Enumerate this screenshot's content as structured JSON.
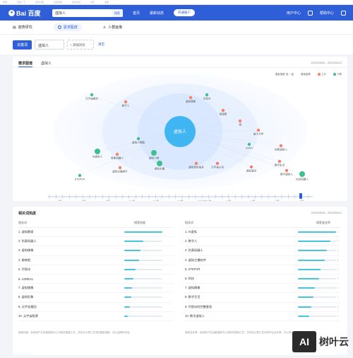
{
  "browser_bar": {
    "items": [
      "微博",
      "百度一下",
      "搜索引擎",
      "百度指数",
      "新标签页",
      "资讯",
      "收藏"
    ]
  },
  "topnav": {
    "logo": "Bai 百度",
    "search_value": "虚拟人",
    "search_button": "搜索",
    "links": [
      "首页",
      "最新动态"
    ],
    "pill": "开通账户",
    "right_items": [
      "用户中心",
      "帮助中心"
    ]
  },
  "subtabs": [
    "趋势研究",
    "需求图谱",
    "人群画像"
  ],
  "keywords": {
    "add_label": "关键词",
    "keyword": "虚拟人",
    "add_compare": "+ 添加对比",
    "clear": "清空"
  },
  "demand_card": {
    "tabs": [
      "需求图谱",
      "虚拟人"
    ],
    "date": "2022/06/06 - 2022/06/12",
    "legend": {
      "search_index_label": "搜索指数",
      "search_index_range": "低 ─ 高",
      "trend_label": "搜索趋势",
      "up": "上升",
      "down": "下降"
    },
    "center_term": "虚拟人",
    "timeline": [
      "6月",
      "7月",
      "8月",
      "10月",
      "11月",
      "12月",
      "2022年1月",
      "2月",
      "3月",
      "5月",
      "6月"
    ],
    "colors": {
      "up": "#f2826b",
      "down": "#3fbf8c",
      "center": "#3fb6f2"
    }
  },
  "chart_data": {
    "type": "bubble",
    "center": "虚拟人",
    "nodes": [
      {
        "label": "元宇宙概念",
        "trend": "down",
        "size": 2
      },
      {
        "label": "数字人",
        "trend": "up",
        "size": 2
      },
      {
        "label": "虚拟偶像",
        "trend": "up",
        "size": 2
      },
      {
        "label": "华智冰",
        "trend": "down",
        "size": 2
      },
      {
        "label": "柳夜熙",
        "trend": "up",
        "size": 2
      },
      {
        "label": "翎",
        "trend": "up",
        "size": 2
      },
      {
        "label": "量子力学",
        "trend": "up",
        "size": 2
      },
      {
        "label": "AYAYI",
        "trend": "down",
        "size": 2
      },
      {
        "label": "STEPVR",
        "trend": "down",
        "size": 2
      },
      {
        "label": "虚拟人物",
        "trend": "down",
        "size": 3
      },
      {
        "label": "AI虚拟人",
        "trend": "down",
        "size": 3
      },
      {
        "label": "创新虚拟人",
        "trend": "up",
        "size": 2
      },
      {
        "label": "虚拟主播",
        "trend": "down",
        "size": 3
      },
      {
        "label": "数字虚拟人",
        "trend": "up",
        "size": 2
      },
      {
        "label": "虚拟人物图",
        "trend": "down",
        "size": 2
      },
      {
        "label": "元宇宙公司",
        "trend": "up",
        "size": 2
      },
      {
        "label": "虚拟演员",
        "trend": "up",
        "size": 2
      },
      {
        "label": "虚拟主播排行",
        "trend": "up",
        "size": 2
      },
      {
        "label": "数字生活",
        "trend": "up",
        "size": 2
      },
      {
        "label": "仿真机器人",
        "trend": "down",
        "size": 3
      },
      {
        "label": "智能机器人",
        "trend": "up",
        "size": 2
      },
      {
        "label": "虚拟现实技术",
        "trend": "up",
        "size": 2
      }
    ]
  },
  "related_card": {
    "title": "相关词热度",
    "date": "2022/06/06 - 2022/06/12",
    "left": {
      "col1": "相关词",
      "col2": "搜索热度",
      "rows": [
        {
          "rank": "1.",
          "term": "虚拟歌姬",
          "value": 1.0
        },
        {
          "rank": "2.",
          "term": "仿真机器人",
          "value": 0.5
        },
        {
          "rank": "3.",
          "term": "虚拟偶像",
          "value": 0.42
        },
        {
          "rank": "4.",
          "term": "柳夜熙",
          "value": 0.38
        },
        {
          "rank": "5.",
          "term": "华智冰",
          "value": 0.3
        },
        {
          "rank": "6.",
          "term": "LOREAL",
          "value": 0.24
        },
        {
          "rank": "7.",
          "term": "虚拟偶像",
          "value": 0.2
        },
        {
          "rank": "8.",
          "term": "虚拟形象",
          "value": 0.18
        },
        {
          "rank": "9.",
          "term": "元宇宙基因",
          "value": 0.14
        },
        {
          "rank": "10.",
          "term": "元宇宙股票",
          "value": 0.1
        }
      ],
      "note": "搜索热度：反映用户在百度搜索中心词相关搜索汇总，并综合计算汇总词的搜索指数，并以此降序排名。"
    },
    "right": {
      "col1": "相关词",
      "col2": "搜索变化率",
      "rows": [
        {
          "rank": "1.",
          "term": "AI虚拟",
          "value": 1.0,
          "trend": "up"
        },
        {
          "rank": "2.",
          "term": "数字人",
          "value": 0.85,
          "trend": "up"
        },
        {
          "rank": "3.",
          "term": "仿真机器人",
          "value": 0.75,
          "trend": "down"
        },
        {
          "rank": "4.",
          "term": "虚拟主播软件",
          "value": 0.7,
          "trend": "down"
        },
        {
          "rank": "5.",
          "term": "STEPVR",
          "value": 0.6,
          "trend": "up"
        },
        {
          "rank": "6.",
          "term": "科技",
          "value": 0.55,
          "trend": "up"
        },
        {
          "rank": "7.",
          "term": "虚拟偶像",
          "value": 0.45,
          "trend": "down"
        },
        {
          "rank": "8.",
          "term": "数字生活",
          "value": 0.4,
          "trend": "up"
        },
        {
          "rank": "9.",
          "term": "华智冰的完整意思",
          "value": 0.35,
          "trend": "down"
        },
        {
          "rank": "10.",
          "term": "数字虚拟人",
          "value": 0.3,
          "trend": "down"
        }
      ],
      "note": "搜索变化率：反映用户在百度搜索中心词相关搜索汇总，并综合计算汇总词的环比变化率，并以变化率的绝对值降序排名。"
    }
  },
  "watermark": {
    "badge": "AI",
    "text": "树叶云"
  }
}
